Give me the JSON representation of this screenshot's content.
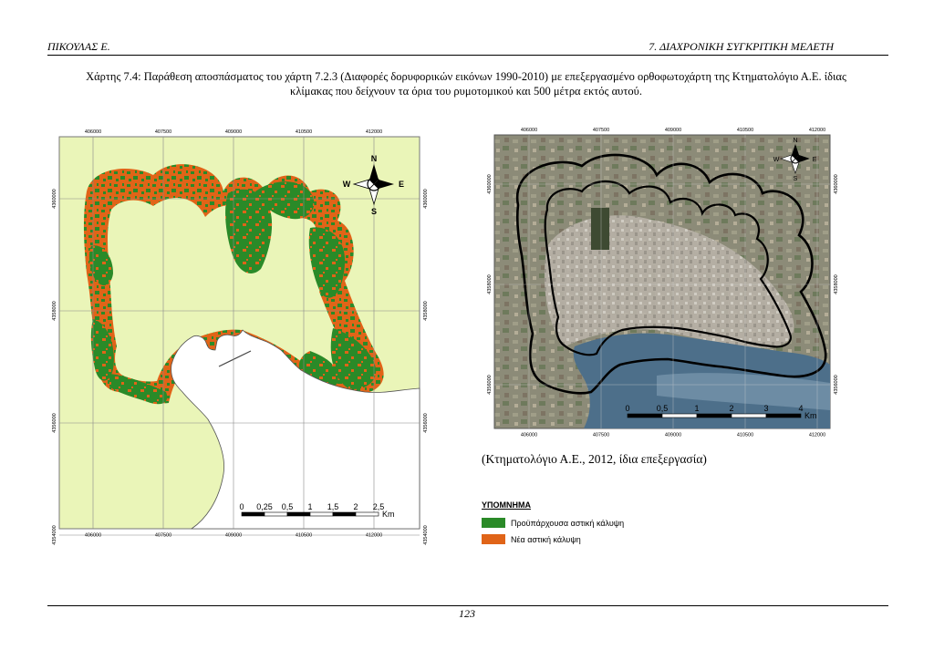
{
  "header": {
    "left": "ΠΙΚΟΥΛΑΣ Ε.",
    "right": "7. ΔΙΑΧΡΟΝΙΚΗ ΣΥΓΚΡΙΤΙΚΗ ΜΕΛΕΤΗ"
  },
  "caption_line1": "Χάρτης 7.4: Παράθεση αποσπάσματος του χάρτη 7.2.3 (Διαφορές δορυφορικών εικόνων 1990-2010) με επεξεργασμένο ορθοφωτοχάρτη της Κτηματολόγιο Α.Ε. ίδιας",
  "caption_line2": "κλίμακας που δείχνουν τα όρια του ρυμοτομικού και 500 μέτρα εκτός αυτού.",
  "source": "(Κτηματολόγιο Α.Ε., 2012, ίδια επεξεργασία)",
  "page_number": "123",
  "colors": {
    "existing": "#2a8a28",
    "new": "#e06418",
    "land": "#eaf5b8",
    "sea": "#ffffff",
    "water": "#5a7d9a"
  },
  "map_left": {
    "x_ticks": [
      "406000",
      "407500",
      "409000",
      "410500",
      "412000"
    ],
    "y_ticks": [
      "4360000",
      "4358000",
      "4356000",
      "4354000"
    ],
    "compass": {
      "n": "N",
      "s": "S",
      "e": "E",
      "w": "W"
    },
    "scale_labels": [
      "0",
      "0,25",
      "0,5",
      "1",
      "1,5",
      "2",
      "2,5"
    ],
    "scale_unit": "Km"
  },
  "map_right": {
    "x_ticks": [
      "406000",
      "407500",
      "409000",
      "410500",
      "412000"
    ],
    "y_ticks": [
      "4360000",
      "4358000",
      "4356000"
    ],
    "compass": {
      "n": "N",
      "s": "S",
      "e": "E",
      "w": "W"
    },
    "scale_labels": [
      "0",
      "0,5",
      "1",
      "2",
      "3",
      "4"
    ],
    "scale_unit": "Km"
  },
  "legend": {
    "title": "ΥΠΟΜΝΗΜΑ",
    "items": [
      {
        "label": "Προϋπάρχουσα αστική κάλυψη",
        "color": "#2a8a28"
      },
      {
        "label": "Νέα αστική κάλυψη",
        "color": "#e06418"
      }
    ]
  }
}
